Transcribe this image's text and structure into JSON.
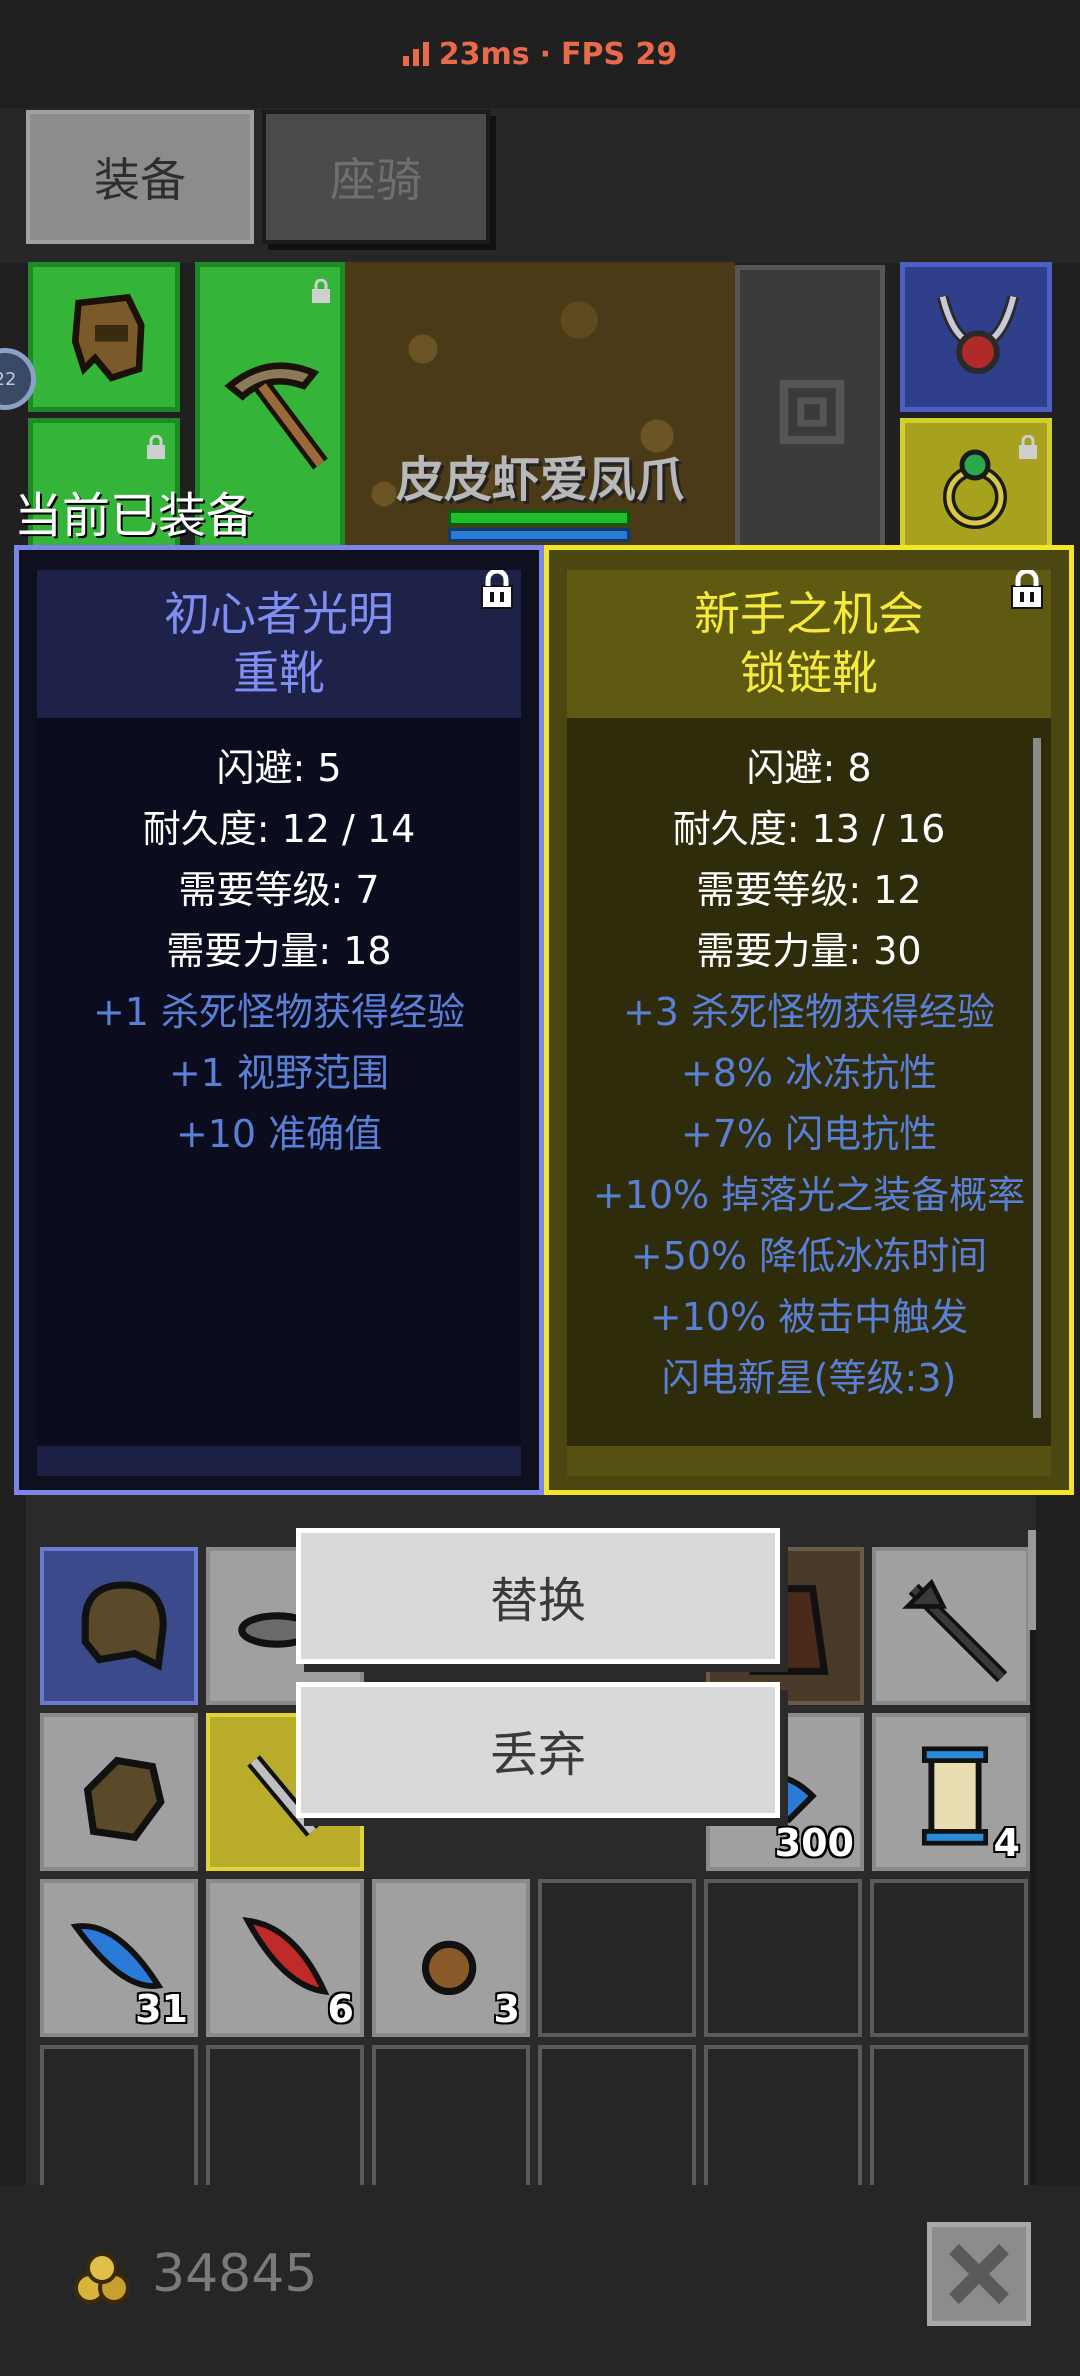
{
  "status": {
    "ping": "23ms",
    "separator": "·",
    "fps": "FPS 29"
  },
  "tabs": [
    {
      "label": "装备",
      "active": true
    },
    {
      "label": "座骑",
      "active": false
    }
  ],
  "character": {
    "name": "皮皮虾爱凤爪"
  },
  "side_badge": "22",
  "equipped_label": "当前已装备",
  "cards": {
    "current": {
      "name": "初心者光明",
      "type": "重靴",
      "stats": [
        "闪避: 5",
        "耐久度: 12 / 14",
        "需要等级: 7",
        "需要力量: 18"
      ],
      "bonuses": [
        "+1 杀死怪物获得经验",
        "+1 视野范围",
        "+10 准确值"
      ]
    },
    "new": {
      "name": "新手之机会",
      "type": "锁链靴",
      "stats": [
        "闪避: 8",
        "耐久度: 13 / 16",
        "需要等级: 12",
        "需要力量: 30"
      ],
      "bonuses": [
        "+3 杀死怪物获得经验",
        "+8% 冰冻抗性",
        "+7% 闪电抗性",
        "+10% 掉落光之装备概率",
        "+50% 降低冰冻时间",
        "+10% 被击中触发",
        "闪电新星(等级:3)"
      ]
    }
  },
  "actions": {
    "replace": "替换",
    "discard": "丢弃"
  },
  "inventory": {
    "counts": {
      "potion": "300",
      "scroll": "4",
      "blue_feather": "31",
      "red_feather": "6",
      "ore": "3"
    }
  },
  "gold": "34845",
  "colors": {
    "status_accent": "#e86a4a",
    "magic_blue": "#7f8ef2",
    "rare_yellow": "#f6eb3c",
    "bonus_text": "#5a7fd6"
  }
}
